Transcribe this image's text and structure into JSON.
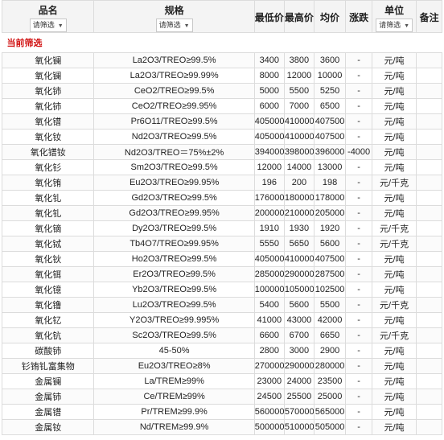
{
  "headers": {
    "name": "品名",
    "spec": "规格",
    "min": "最低价",
    "max": "最高价",
    "avg": "均价",
    "change": "涨跌",
    "unit": "单位",
    "note": "备注",
    "filter_label": "请筛选"
  },
  "current_filter_label": "当前筛选",
  "rows": [
    {
      "name": "氧化镧",
      "spec": "La2O3/TREO≥99.5%",
      "min": "3400",
      "max": "3800",
      "avg": "3600",
      "change": "-",
      "unit": "元/吨"
    },
    {
      "name": "氧化镧",
      "spec": "La2O3/TREO≥99.99%",
      "min": "8000",
      "max": "12000",
      "avg": "10000",
      "change": "-",
      "unit": "元/吨"
    },
    {
      "name": "氧化铈",
      "spec": "CeO2/TREO≥99.5%",
      "min": "5000",
      "max": "5500",
      "avg": "5250",
      "change": "-",
      "unit": "元/吨"
    },
    {
      "name": "氧化铈",
      "spec": "CeO2/TREO≥99.95%",
      "min": "6000",
      "max": "7000",
      "avg": "6500",
      "change": "-",
      "unit": "元/吨"
    },
    {
      "name": "氧化镨",
      "spec": "Pr6O11/TREO≥99.5%",
      "min": "405000",
      "max": "410000",
      "avg": "407500",
      "change": "-",
      "unit": "元/吨"
    },
    {
      "name": "氧化钕",
      "spec": "Nd2O3/TREO≥99.5%",
      "min": "405000",
      "max": "410000",
      "avg": "407500",
      "change": "-",
      "unit": "元/吨"
    },
    {
      "name": "氧化镨钕",
      "spec": "Nd2O3/TREO＝75%±2%",
      "min": "394000",
      "max": "398000",
      "avg": "396000",
      "change": "-4000",
      "unit": "元/吨"
    },
    {
      "name": "氧化钐",
      "spec": "Sm2O3/TREO≥99.5%",
      "min": "12000",
      "max": "14000",
      "avg": "13000",
      "change": "-",
      "unit": "元/吨"
    },
    {
      "name": "氧化铕",
      "spec": "Eu2O3/TREO≥99.95%",
      "min": "196",
      "max": "200",
      "avg": "198",
      "change": "-",
      "unit": "元/千克"
    },
    {
      "name": "氧化钆",
      "spec": "Gd2O3/TREO≥99.5%",
      "min": "176000",
      "max": "180000",
      "avg": "178000",
      "change": "-",
      "unit": "元/吨"
    },
    {
      "name": "氧化钆",
      "spec": "Gd2O3/TREO≥99.95%",
      "min": "200000",
      "max": "210000",
      "avg": "205000",
      "change": "-",
      "unit": "元/吨"
    },
    {
      "name": "氧化镝",
      "spec": "Dy2O3/TREO≥99.5%",
      "min": "1910",
      "max": "1930",
      "avg": "1920",
      "change": "-",
      "unit": "元/千克"
    },
    {
      "name": "氧化铽",
      "spec": "Tb4O7/TREO≥99.95%",
      "min": "5550",
      "max": "5650",
      "avg": "5600",
      "change": "-",
      "unit": "元/千克"
    },
    {
      "name": "氧化钬",
      "spec": "Ho2O3/TREO≥99.5%",
      "min": "405000",
      "max": "410000",
      "avg": "407500",
      "change": "-",
      "unit": "元/吨"
    },
    {
      "name": "氧化铒",
      "spec": "Er2O3/TREO≥99.5%",
      "min": "285000",
      "max": "290000",
      "avg": "287500",
      "change": "-",
      "unit": "元/吨"
    },
    {
      "name": "氧化镱",
      "spec": "Yb2O3/TREO≥99.5%",
      "min": "100000",
      "max": "105000",
      "avg": "102500",
      "change": "-",
      "unit": "元/吨"
    },
    {
      "name": "氧化镥",
      "spec": "Lu2O3/TREO≥99.5%",
      "min": "5400",
      "max": "5600",
      "avg": "5500",
      "change": "-",
      "unit": "元/千克"
    },
    {
      "name": "氧化钇",
      "spec": "Y2O3/TREO≥99.995%",
      "min": "41000",
      "max": "43000",
      "avg": "42000",
      "change": "-",
      "unit": "元/吨"
    },
    {
      "name": "氧化钪",
      "spec": "Sc2O3/TREO≥99.5%",
      "min": "6600",
      "max": "6700",
      "avg": "6650",
      "change": "-",
      "unit": "元/千克"
    },
    {
      "name": "碳酸铈",
      "spec": "45-50%",
      "min": "2800",
      "max": "3000",
      "avg": "2900",
      "change": "-",
      "unit": "元/吨"
    },
    {
      "name": "钐铕钆富集物",
      "spec": "Eu2O3/TREO≥8%",
      "min": "270000",
      "max": "290000",
      "avg": "280000",
      "change": "-",
      "unit": "元/吨"
    },
    {
      "name": "金属镧",
      "spec": "La/TREM≥99%",
      "min": "23000",
      "max": "24000",
      "avg": "23500",
      "change": "-",
      "unit": "元/吨"
    },
    {
      "name": "金属铈",
      "spec": "Ce/TREM≥99%",
      "min": "24500",
      "max": "25500",
      "avg": "25000",
      "change": "-",
      "unit": "元/吨"
    },
    {
      "name": "金属镨",
      "spec": "Pr/TREM≥99.9%",
      "min": "560000",
      "max": "570000",
      "avg": "565000",
      "change": "-",
      "unit": "元/吨"
    },
    {
      "name": "金属钕",
      "spec": "Nd/TREM≥99.9%",
      "min": "500000",
      "max": "510000",
      "avg": "505000",
      "change": "-",
      "unit": "元/吨"
    }
  ]
}
